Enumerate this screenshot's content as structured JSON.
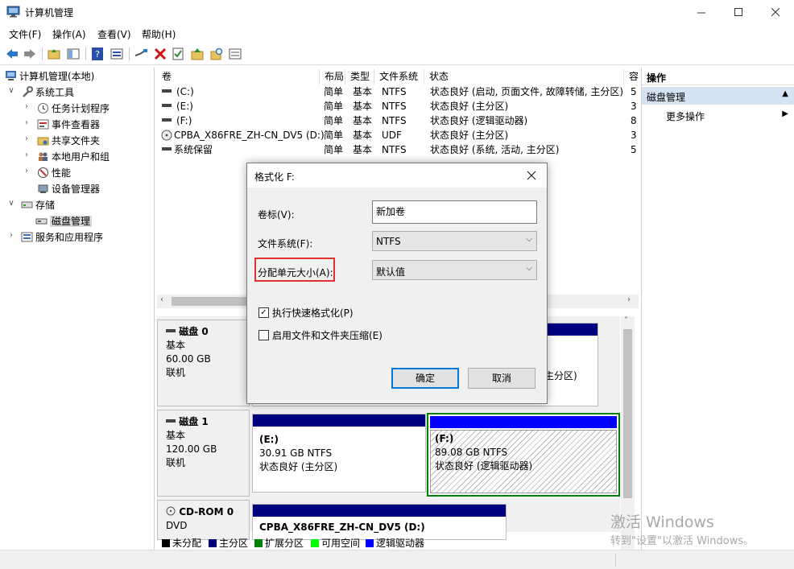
{
  "window": {
    "title": "计算机管理"
  },
  "menu": {
    "items": [
      "文件(F)",
      "操作(A)",
      "查看(V)",
      "帮助(H)"
    ]
  },
  "tree": {
    "root": "计算机管理(本地)",
    "system_tools": "系统工具",
    "task_scheduler": "任务计划程序",
    "event_viewer": "事件查看器",
    "shared_folders": "共享文件夹",
    "local_users": "本地用户和组",
    "performance": "性能",
    "device_manager": "设备管理器",
    "storage": "存储",
    "disk_management": "磁盘管理",
    "services": "服务和应用程序"
  },
  "volumes": {
    "headers": {
      "vol": "卷",
      "layout": "布局",
      "type": "类型",
      "fs": "文件系统",
      "status": "状态",
      "cap": "容"
    },
    "rows": [
      {
        "name": "(C:)",
        "layout": "简单",
        "type": "基本",
        "fs": "NTFS",
        "status": "状态良好 (启动, 页面文件, 故障转储, 主分区)",
        "cap": "5"
      },
      {
        "name": "(E:)",
        "layout": "简单",
        "type": "基本",
        "fs": "NTFS",
        "status": "状态良好 (主分区)",
        "cap": "3"
      },
      {
        "name": "(F:)",
        "layout": "简单",
        "type": "基本",
        "fs": "NTFS",
        "status": "状态良好 (逻辑驱动器)",
        "cap": "8"
      },
      {
        "name": "CPBA_X86FRE_ZH-CN_DV5 (D:)",
        "layout": "简单",
        "type": "基本",
        "fs": "UDF",
        "status": "状态良好 (主分区)",
        "cap": "3"
      },
      {
        "name": "系统保留",
        "layout": "简单",
        "type": "基本",
        "fs": "NTFS",
        "status": "状态良好 (系统, 活动, 主分区)",
        "cap": "5"
      }
    ]
  },
  "actions": {
    "header": "操作",
    "section": "磁盘管理",
    "more": "更多操作"
  },
  "disks": {
    "disk0": {
      "name": "磁盘 0",
      "type": "基本",
      "size": "60.00 GB",
      "state": "联机",
      "partial_text": "主分区)"
    },
    "disk1": {
      "name": "磁盘 1",
      "type": "基本",
      "size": "120.00 GB",
      "state": "联机",
      "e": {
        "label": "(E:)",
        "size": "30.91 GB NTFS",
        "status": "状态良好 (主分区)"
      },
      "f": {
        "label": "(F:)",
        "size": "89.08 GB NTFS",
        "status": "状态良好 (逻辑驱动器)"
      }
    },
    "cdrom": {
      "name": "CD-ROM 0",
      "type": "DVD",
      "vol": "CPBA_X86FRE_ZH-CN_DV5  (D:)"
    }
  },
  "legend": {
    "unallocated": "未分配",
    "primary": "主分区",
    "extended": "扩展分区",
    "free": "可用空间",
    "logical": "逻辑驱动器"
  },
  "dialog": {
    "title": "格式化 F:",
    "volume_label": "卷标(V):",
    "volume_value": "新加卷",
    "fs_label": "文件系统(F):",
    "fs_value": "NTFS",
    "alloc_label": "分配单元大小(A):",
    "alloc_value": "默认值",
    "quick_format": "执行快速格式化(P)",
    "quick_format_checked": true,
    "compress": "启用文件和文件夹压缩(E)",
    "compress_checked": false,
    "ok": "确定",
    "cancel": "取消"
  },
  "watermark": {
    "line1": "激活 Windows",
    "line2": "转到\"设置\"以激活 Windows。"
  },
  "colors": {
    "primary": "#000080",
    "logical": "#0000ff",
    "extended": "#008000",
    "free": "#00ff00",
    "highlight": "#e03030",
    "accent": "#0078d7"
  }
}
